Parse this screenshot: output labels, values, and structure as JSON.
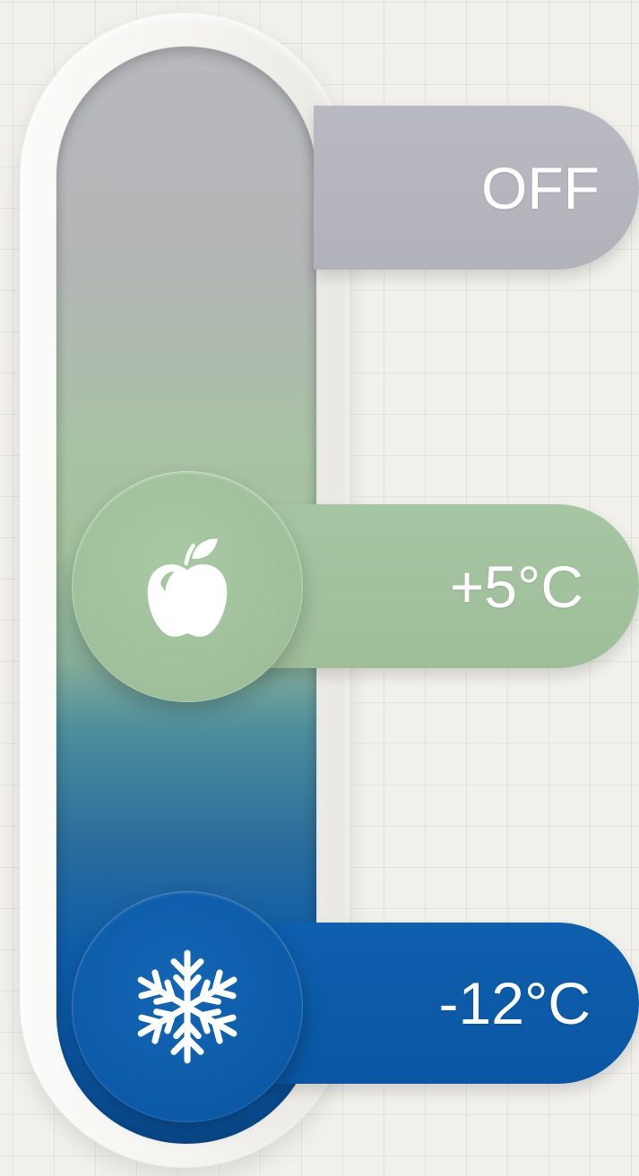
{
  "thermostat": {
    "settings": [
      {
        "id": "off",
        "label": "OFF",
        "color": "#b5b6bd"
      },
      {
        "id": "fridge",
        "label": "+5°C",
        "icon": "apple-icon",
        "color": "#a2c29d"
      },
      {
        "id": "freezer",
        "label": "-12°C",
        "icon": "snowflake-icon",
        "color": "#0b58a5"
      }
    ],
    "track_colors": [
      "#b8b8be",
      "#a2c29d",
      "#4f8f9d",
      "#0b58a5"
    ]
  }
}
